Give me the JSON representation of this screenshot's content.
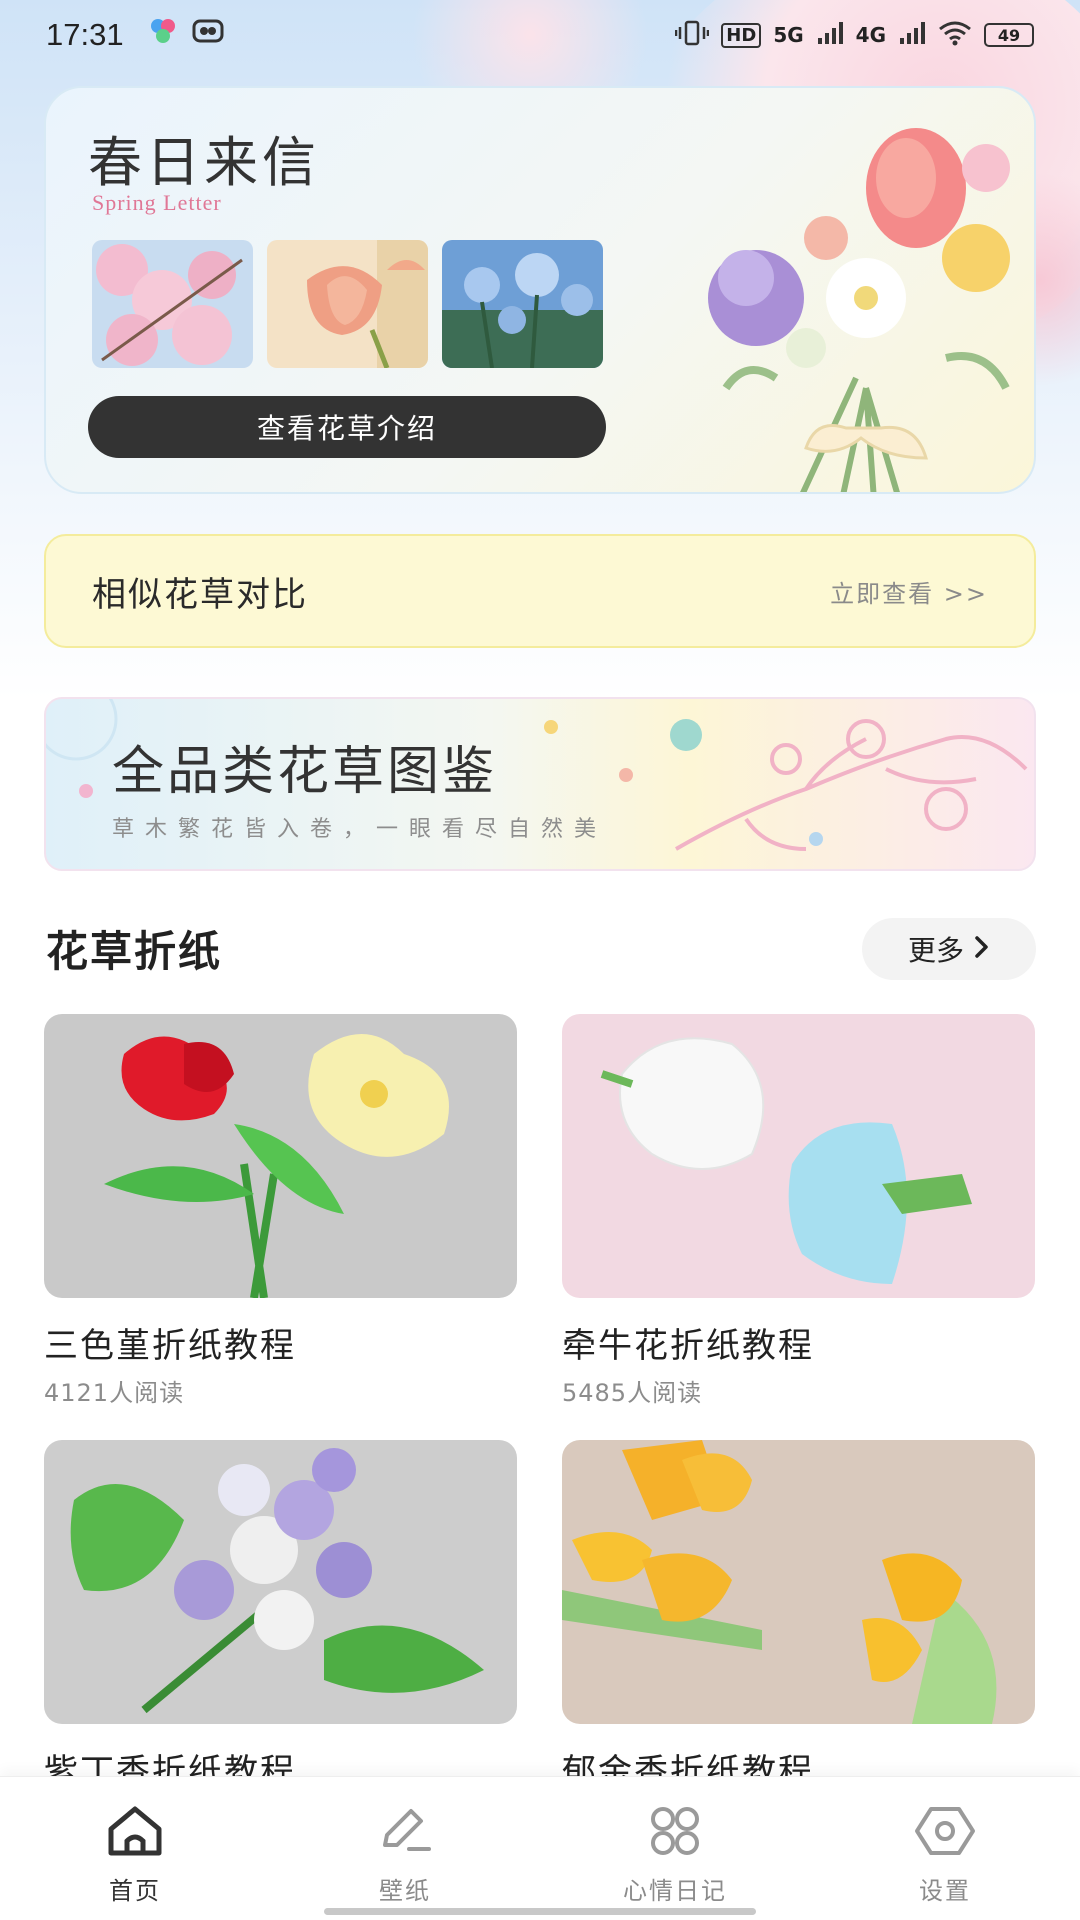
{
  "status_bar": {
    "time": "17:31",
    "network_labels": [
      "HD",
      "5G",
      "4G"
    ],
    "battery": "49"
  },
  "spring_card": {
    "title": "春日来信",
    "subtitle": "Spring Letter",
    "button_label": "查看花草介绍",
    "thumbnails": [
      "cherry-blossom-photo",
      "tulip-photo",
      "blue-flower-photo"
    ]
  },
  "compare": {
    "title": "相似花草对比",
    "link_label": "立即查看 >>"
  },
  "catalog": {
    "title": "全品类花草图鉴",
    "subtitle": "草木繁花皆入卷，一眼看尽自然美"
  },
  "origami_section": {
    "title": "花草折纸",
    "more_label": "更多",
    "items": [
      {
        "title": "三色堇折纸教程",
        "reads": "4121人阅读"
      },
      {
        "title": "牵牛花折纸教程",
        "reads": "5485人阅读"
      },
      {
        "title": "紫丁香折纸教程",
        "reads": ""
      },
      {
        "title": "郁金香折纸教程",
        "reads": ""
      }
    ]
  },
  "tab_bar": {
    "tabs": [
      {
        "label": "首页",
        "icon": "home-icon",
        "active": true
      },
      {
        "label": "壁纸",
        "icon": "pen-icon",
        "active": false
      },
      {
        "label": "心情日记",
        "icon": "grid-icon",
        "active": false
      },
      {
        "label": "设置",
        "icon": "settings-icon",
        "active": false
      }
    ]
  },
  "colors": {
    "button_dark": "#333333",
    "compare_bg": "#fdf9d4",
    "subtitle_pink": "#e07796",
    "muted_text": "#8c8c8c"
  }
}
